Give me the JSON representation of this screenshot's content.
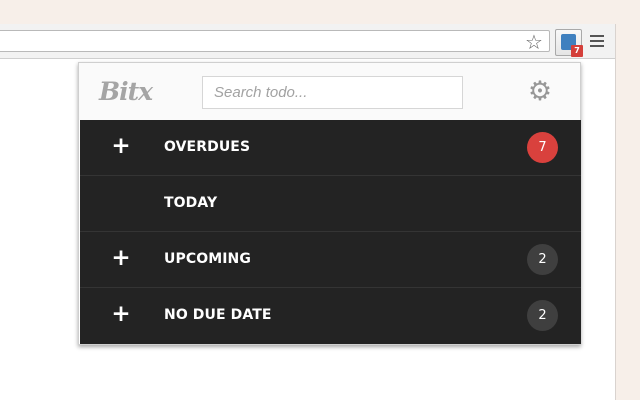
{
  "browser": {
    "toolbar": {
      "bookmark_icon": "star-icon",
      "extension": {
        "icon": "bitx-extension-icon",
        "badge_count": "7",
        "badge_color": "#d43f3a"
      },
      "menu_icon": "hamburger-menu-icon"
    }
  },
  "popup": {
    "brand": "Bitx",
    "search": {
      "placeholder": "Search todo..."
    },
    "settings_icon": "gear-icon",
    "sections": [
      {
        "label": "OVERDUES",
        "has_add": true,
        "add_symbol": "+",
        "count": "7",
        "count_color": "#d9413d"
      },
      {
        "label": "TODAY",
        "has_add": false,
        "add_symbol": "",
        "count": "",
        "count_color": ""
      },
      {
        "label": "UPCOMING",
        "has_add": true,
        "add_symbol": "+",
        "count": "2",
        "count_color": "#3f3f3f"
      },
      {
        "label": "NO DUE DATE",
        "has_add": true,
        "add_symbol": "+",
        "count": "2",
        "count_color": "#3f3f3f"
      }
    ]
  },
  "colors": {
    "page_background": "#f7efe9",
    "list_background": "#232323",
    "row_divider": "#343434",
    "header_background": "#fafafa"
  }
}
